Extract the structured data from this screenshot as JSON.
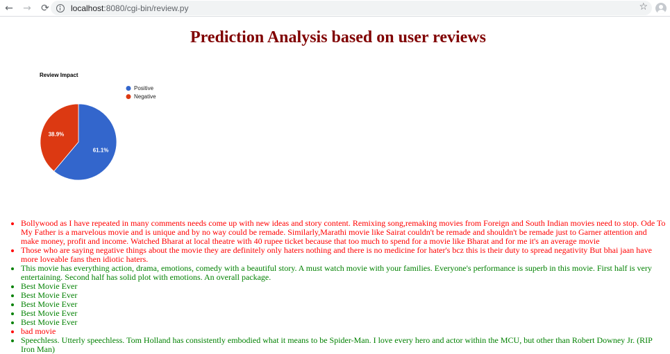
{
  "browser": {
    "url_host": "localhost",
    "url_path": ":8080/cgi-bin/review.py",
    "back_glyph": "←",
    "forward_glyph": "→",
    "reload_glyph": "⟳",
    "star_glyph": "☆"
  },
  "page": {
    "title": "Prediction Analysis based on user reviews"
  },
  "chart_data": {
    "type": "pie",
    "title": "Review Impact",
    "categories": [
      "Positive",
      "Negative"
    ],
    "values": [
      61.1,
      38.9
    ],
    "labels": [
      "61.1%",
      "38.9%"
    ],
    "colors": [
      "#3366cc",
      "#dc3912"
    ],
    "legend": "right"
  },
  "reviews": [
    {
      "sentiment": "negative",
      "text": "Bollywood as I have repeated in many comments needs come up with new ideas and story content. Remixing song,remaking movies from Foreign and South Indian movies need to stop. Ode To My Father is a marvelous movie and is unique and by no way could be remade. Similarly,Marathi movie like Sairat couldn't be remade and shouldn't be remade just to Garner attention and make money, profit and income. Watched Bharat at local theatre with 40 rupee ticket because that too much to spend for a movie like Bharat and for me it's an average movie"
    },
    {
      "sentiment": "negative",
      "text": "Those who are saying negative things about the movie they are definitely only haters nothing and there is no medicine for hater's bcz this is their duty to spread negativity But bhai jaan have more loveable fans then idiotic haters."
    },
    {
      "sentiment": "positive",
      "text": "This movie has everything action, drama, emotions, comedy with a beautiful story. A must watch movie with your families. Everyone's performance is superb in this movie. First half is very entertaining. Second half has solid plot with emotions. An overall package."
    },
    {
      "sentiment": "positive",
      "text": "Best Movie Ever"
    },
    {
      "sentiment": "positive",
      "text": "Best Movie Ever"
    },
    {
      "sentiment": "positive",
      "text": "Best Movie Ever"
    },
    {
      "sentiment": "positive",
      "text": "Best Movie Ever"
    },
    {
      "sentiment": "positive",
      "text": "Best Movie Ever"
    },
    {
      "sentiment": "negative",
      "text": "bad movie"
    },
    {
      "sentiment": "positive",
      "text": "Speechless. Utterly speechless. Tom Holland has consistently embodied what it means to be Spider-Man. I love every hero and actor within the MCU, but other than Robert Downey Jr. (RIP Iron Man)"
    }
  ]
}
